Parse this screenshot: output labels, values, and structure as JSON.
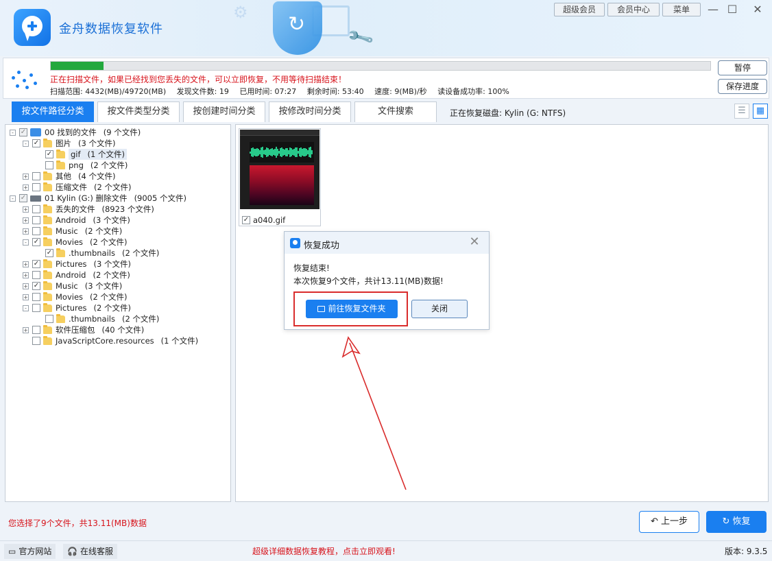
{
  "app": {
    "title": "金舟数据恢复软件"
  },
  "top_buttons": {
    "vip": "超级会员",
    "member_center": "会员中心",
    "menu": "菜单"
  },
  "window_controls": {
    "minimize": "—",
    "maximize": "☐",
    "close": "✕"
  },
  "scan": {
    "progress": 0.08,
    "message": "正在扫描文件，如果已经找到您丢失的文件，可以立即恢复，不用等待扫描结束！",
    "range": "扫描范围: 4432(MB)/49720(MB)",
    "found": "发现文件数: 19",
    "elapsed": "已用时间: 07:27",
    "remaining": "剩余时间: 53:40",
    "speed": "速度: 9(MB)/秒",
    "success_rate": "读设备成功率: 100%",
    "pause_label": "暂停",
    "save_label": "保存进度"
  },
  "tabs": [
    {
      "label": "按文件路径分类",
      "active": true
    },
    {
      "label": "按文件类型分类",
      "active": false
    },
    {
      "label": "按创建时间分类",
      "active": false
    },
    {
      "label": "按修改时间分类",
      "active": false
    },
    {
      "label": "文件搜索",
      "active": false
    }
  ],
  "disk_info": "正在恢复磁盘: Kylin (G: NTFS)",
  "tree": [
    {
      "label": "00 找到的文件",
      "count": "(9 个文件)",
      "indent": 0,
      "exp": "-",
      "checked": "partial",
      "icon": "found"
    },
    {
      "label": "图片",
      "count": "(3 个文件)",
      "indent": 1,
      "exp": "-",
      "checked": "checked",
      "icon": "folder"
    },
    {
      "label": "gif",
      "count": "(1 个文件)",
      "indent": 2,
      "exp": "",
      "checked": "checked",
      "icon": "folder",
      "selected": true
    },
    {
      "label": "png",
      "count": "(2 个文件)",
      "indent": 2,
      "exp": "",
      "checked": "",
      "icon": "folder"
    },
    {
      "label": "其他",
      "count": "(4 个文件)",
      "indent": 1,
      "exp": "+",
      "checked": "",
      "icon": "folder"
    },
    {
      "label": "压缩文件",
      "count": "(2 个文件)",
      "indent": 1,
      "exp": "+",
      "checked": "",
      "icon": "folder"
    },
    {
      "label": "01 Kylin (G:) 删除文件",
      "count": "(9005 个文件)",
      "indent": 0,
      "exp": "-",
      "checked": "partial",
      "icon": "drive"
    },
    {
      "label": "丢失的文件",
      "count": "(8923 个文件)",
      "indent": 1,
      "exp": "+",
      "checked": "",
      "icon": "folder"
    },
    {
      "label": "Android",
      "count": "(3 个文件)",
      "indent": 1,
      "exp": "+",
      "checked": "",
      "icon": "folder"
    },
    {
      "label": "Music",
      "count": "(2 个文件)",
      "indent": 1,
      "exp": "+",
      "checked": "",
      "icon": "folder"
    },
    {
      "label": "Movies",
      "count": "(2 个文件)",
      "indent": 1,
      "exp": "-",
      "checked": "checked",
      "icon": "folder"
    },
    {
      "label": ".thumbnails",
      "count": "(2 个文件)",
      "indent": 2,
      "exp": "",
      "checked": "checked",
      "icon": "folder"
    },
    {
      "label": "Pictures",
      "count": "(3 个文件)",
      "indent": 1,
      "exp": "+",
      "checked": "checked",
      "icon": "folder"
    },
    {
      "label": "Android",
      "count": "(2 个文件)",
      "indent": 1,
      "exp": "+",
      "checked": "",
      "icon": "folder"
    },
    {
      "label": "Music",
      "count": "(3 个文件)",
      "indent": 1,
      "exp": "+",
      "checked": "checked",
      "icon": "folder"
    },
    {
      "label": "Movies",
      "count": "(2 个文件)",
      "indent": 1,
      "exp": "+",
      "checked": "",
      "icon": "folder"
    },
    {
      "label": "Pictures",
      "count": "(2 个文件)",
      "indent": 1,
      "exp": "-",
      "checked": "",
      "icon": "folder"
    },
    {
      "label": ".thumbnails",
      "count": "(2 个文件)",
      "indent": 2,
      "exp": "",
      "checked": "",
      "icon": "folder"
    },
    {
      "label": "软件压缩包",
      "count": "(40 个文件)",
      "indent": 1,
      "exp": "+",
      "checked": "",
      "icon": "folder"
    },
    {
      "label": "JavaScriptCore.resources",
      "count": "(1 个文件)",
      "indent": 1,
      "exp": "",
      "checked": "",
      "icon": "folder"
    }
  ],
  "file": {
    "name": "a040.gif",
    "checked": true
  },
  "dialog": {
    "title": "恢复成功",
    "line1": "恢复结束!",
    "line2": "本次恢复9个文件，共计13.11(MB)数据!",
    "open_folder_label": "前往恢复文件夹",
    "close_label": "关闭"
  },
  "selection_info": "您选择了9个文件，共13.11(MB)数据",
  "nav": {
    "prev_label": "上一步",
    "recover_label": "恢复"
  },
  "footer": {
    "website": "官方网站",
    "support": "在线客服",
    "tutorial": "超级详细数据恢复教程，点击立即观看!",
    "version": "版本: 9.3.5"
  },
  "colors": {
    "accent": "#1a7ff0",
    "warning": "#d7141c",
    "progress": "#23a83d",
    "annotation": "#d92b2b"
  }
}
